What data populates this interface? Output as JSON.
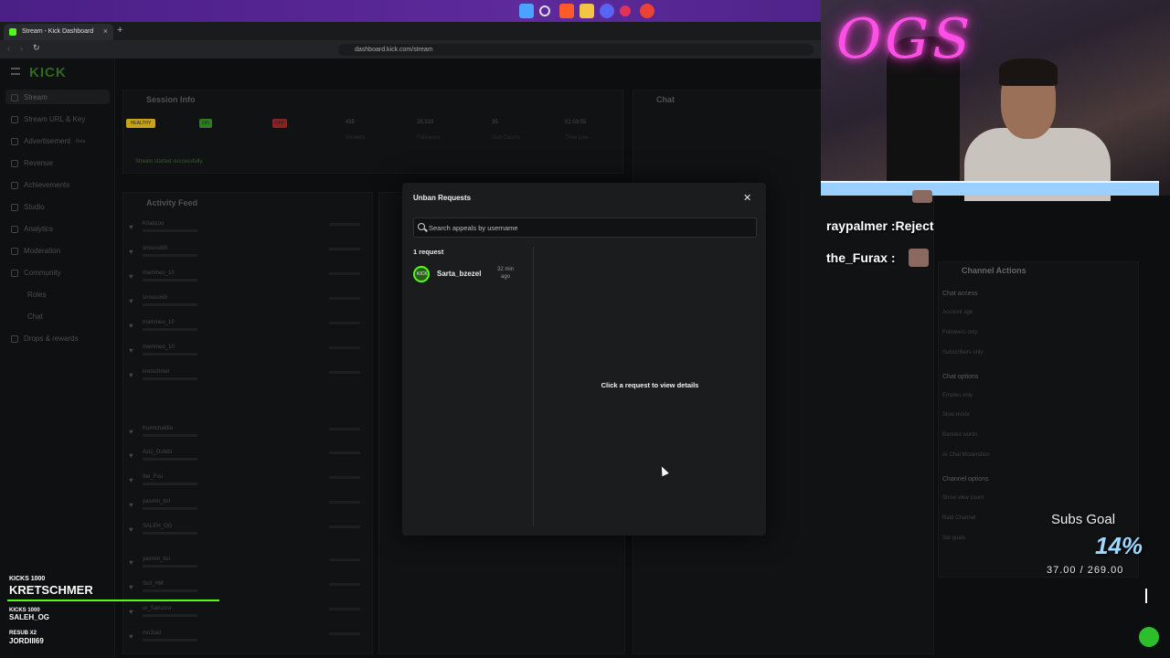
{
  "browser": {
    "tab_title": "Stream - Kick Dashboard",
    "url": "dashboard.kick.com/stream"
  },
  "dashboard": {
    "logo": "KICK",
    "sidebar": [
      "Stream",
      "Stream URL & Key",
      "Advertisement",
      "Revenue",
      "Achievements",
      "Studio",
      "Analytics",
      "Moderation",
      "Community",
      "Roles",
      "Chat",
      "Drops & rewards"
    ],
    "advertisement_badge": "Beta",
    "session_info_title": "Session Info",
    "session_status": "Stream started successfully.",
    "session_stats": [
      {
        "value": "455",
        "label": "Viewers"
      },
      {
        "value": "28,510",
        "label": "Followers"
      },
      {
        "value": "35",
        "label": "Sub Counts"
      },
      {
        "value": "01:03:55",
        "label": "Time Live"
      }
    ],
    "activity_title": "Activity Feed",
    "activity_users": [
      "Kitabzou",
      "snoussi69",
      "mamineo_10",
      "snoussi69",
      "mamineo_10",
      "mamineo_10",
      "kretschmer",
      "Kumtchaldia",
      "Aziz_Ouhibi",
      "the_Fou",
      "yasmin_bsl",
      "SALEH_OG",
      "yasmin_bsl",
      "Sull_HM",
      "ur_Sanoura",
      "mo3tad"
    ],
    "chat_title": "Chat",
    "channel_actions_title": "Channel Actions",
    "channel_actions": [
      "Chat access",
      "Account age",
      "Followers only",
      "Subscribers only",
      "Chat options",
      "Emotes only",
      "Slow mode",
      "Banned words",
      "AI Chat Moderation",
      "Channel options",
      "Show view count",
      "Raid Channel",
      "Set goals"
    ]
  },
  "modal": {
    "title": "Unban Requests",
    "search_placeholder": "Search appeals by username",
    "request_count": "1 request",
    "requests": [
      {
        "username": "Sarta_bzezel",
        "time": "32 min ago"
      }
    ],
    "detail_hint": "Click a request to view details"
  },
  "overlay": {
    "chat": [
      {
        "user": "raypalmer",
        "message": ":Reject"
      },
      {
        "user": "the_Furax",
        "message": ":"
      }
    ],
    "subs_goal": {
      "title": "Subs Goal",
      "percent": "14%",
      "progress": "37.00 / 269.00"
    },
    "kicks": [
      {
        "label": "KICKS 1000",
        "user": "KRETSCHMER"
      },
      {
        "label": "KICKS 1000",
        "user": "SALEH_OG"
      },
      {
        "label": "RESUB X2",
        "user": "JORDIII69"
      }
    ],
    "neon_sign": "OGS"
  }
}
